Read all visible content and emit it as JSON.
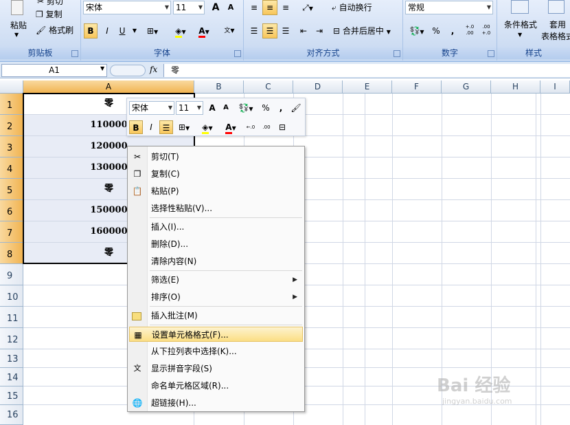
{
  "ribbon": {
    "clipboard": {
      "paste": "粘贴",
      "cut": "剪切",
      "copy": "复制",
      "format_painter": "格式刷",
      "group": "剪贴板"
    },
    "font": {
      "name": "宋体",
      "size": "11",
      "bold": "B",
      "italic": "I",
      "underline": "U",
      "grow": "A",
      "shrink": "A",
      "group": "字体"
    },
    "alignment": {
      "wrap": "自动换行",
      "merge": "合并后居中",
      "group": "对齐方式"
    },
    "number": {
      "format": "常规",
      "percent": "%",
      "comma": ",",
      "inc_decimal": "+.0 .00",
      "dec_decimal": ".00 +.0",
      "group": "数字"
    },
    "styles": {
      "conditional": "条件格式",
      "table_line1": "套用",
      "table_line2": "表格格式",
      "group": "样式"
    }
  },
  "formula_bar": {
    "name_box": "A1",
    "fx": "fx",
    "value": "零"
  },
  "columns": [
    "A",
    "B",
    "C",
    "D",
    "E",
    "F",
    "G",
    "H",
    "I"
  ],
  "rows": [
    "1",
    "2",
    "3",
    "4",
    "5",
    "6",
    "7",
    "8",
    "9",
    "10",
    "11",
    "12",
    "13",
    "14",
    "15",
    "16"
  ],
  "cells_a": [
    "零",
    "110000",
    "120000",
    "130000",
    "零",
    "150000",
    "160000",
    "零"
  ],
  "mini_toolbar": {
    "font": "宋体",
    "size": "11",
    "percent": "%",
    "comma": ",",
    "bold": "B",
    "italic": "I",
    "font_color": "A"
  },
  "context_menu": [
    {
      "label": "剪切(T)",
      "icon": "scissors-icon"
    },
    {
      "label": "复制(C)",
      "icon": "copy-icon"
    },
    {
      "label": "粘贴(P)",
      "icon": "paste-icon"
    },
    {
      "label": "选择性粘贴(V)...",
      "icon": ""
    },
    {
      "label": "插入(I)...",
      "icon": ""
    },
    {
      "label": "删除(D)...",
      "icon": ""
    },
    {
      "label": "清除内容(N)",
      "icon": ""
    },
    {
      "label": "筛选(E)",
      "icon": "",
      "submenu": true
    },
    {
      "label": "排序(O)",
      "icon": "",
      "submenu": true
    },
    {
      "label": "插入批注(M)",
      "icon": "comment-icon"
    },
    {
      "label": "设置单元格格式(F)...",
      "icon": "format-cells-icon",
      "highlighted": true
    },
    {
      "label": "从下拉列表中选择(K)...",
      "icon": ""
    },
    {
      "label": "显示拼音字段(S)",
      "icon": "phonetic-icon"
    },
    {
      "label": "命名单元格区域(R)...",
      "icon": ""
    },
    {
      "label": "超链接(H)...",
      "icon": "hyperlink-icon"
    }
  ],
  "watermark": {
    "brand": "Bai 经验",
    "url": "jingyan.baidu.com"
  },
  "colors": {
    "accent": "#f8c65a",
    "ribbon": "#d2e0f4",
    "group_label": "#15428b"
  }
}
